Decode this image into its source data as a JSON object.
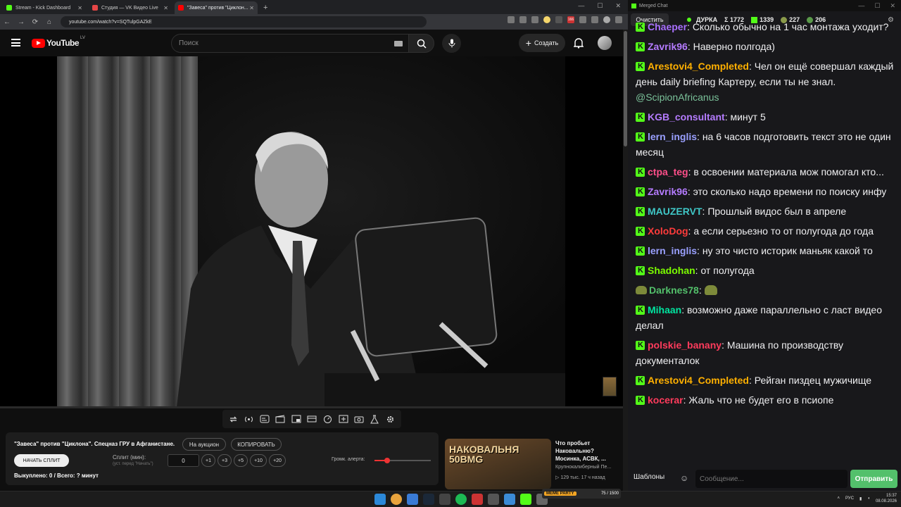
{
  "browser": {
    "tabs": [
      {
        "label": "Stream - Kick Dashboard",
        "color": "#53fc18"
      },
      {
        "label": "Студия — VK Видео Live",
        "color": "#e64646"
      },
      {
        "label": "\"Завеса\" против \"Циклон...",
        "color": "#ff0000"
      }
    ],
    "url": "youtube.com/watch?v=SQTulpGAZkE",
    "ext_badge": "166"
  },
  "youtube": {
    "logo": "YouTube",
    "region": "LV",
    "search_placeholder": "Поиск",
    "create_label": "Создать"
  },
  "panel": {
    "title": "\"Завеса\" против \"Циклона\". Спецназ ГРУ в Афганистане.",
    "auction_label": "На аукцион",
    "copy_label": "КОПИРОВАТЬ",
    "start_label": "НАЧАТЬ СПЛИТ",
    "split_label": "Сплит (мин):",
    "split_hint": "(уст. перед \"Начать\")",
    "split_value": "0",
    "increments": [
      "+1",
      "+3",
      "+5",
      "+10",
      "+20"
    ],
    "bought": "Выкуплено: 0 / Всего: ? минут",
    "volume_label": "Громк. алерта:",
    "volume_fraction": 0.22
  },
  "recommended": {
    "thumb_text": "НАКОВАЛЬНЯ 50BMG",
    "title": "Что пробьет Наковальню? Мосинка, АСВК, ...",
    "channel": "Крупнокалиберный Пе...",
    "meta": "▷ 129 тыс.   17 ч назад"
  },
  "chat": {
    "window_title": "Merged Chat",
    "clear_label": "Очистить",
    "channel": "ДУРКА",
    "stat_total": "Σ 1772",
    "stat_kick": "1339",
    "stat_a": "227",
    "stat_b": "206",
    "messages": [
      {
        "user": "Chaeper",
        "color": "#a970ff",
        "text": "Сколько обычно на 1 час монтажа уходит?"
      },
      {
        "user": "Zavrik96",
        "color": "#b57cff",
        "text": "Наверно полгода)"
      },
      {
        "user": "Arestovi4_Completed",
        "color": "#ffb000",
        "text": "Чел он ещё совершал каждый день daily briefing Картеру, если ты не знал.",
        "mention": "@ScipionAfricanus"
      },
      {
        "user": "KGB_consultant",
        "color": "#b57cff",
        "text": "минут 5"
      },
      {
        "user": "lern_inglis",
        "color": "#9aa0ff",
        "text": "на 6 часов подготовить текст это не один месяц"
      },
      {
        "user": "ctpa_teg",
        "color": "#ff4f8a",
        "text": "в освоении материала мож помогал кто..."
      },
      {
        "user": "Zavrik96",
        "color": "#b57cff",
        "text": "это сколько надо времени по поиску инфу"
      },
      {
        "user": "MAUZERVT",
        "color": "#3fc7c7",
        "text": "Прошлый видос был в апреле"
      },
      {
        "user": "XoloDog",
        "color": "#ff3b3b",
        "text": "а если серьезно то от полугода до года"
      },
      {
        "user": "lern_inglis",
        "color": "#9aa0ff",
        "text": "ну это чисто историк маньяк какой то"
      },
      {
        "user": "Shadohan",
        "color": "#7cfc00",
        "text": "от полугода"
      },
      {
        "user": "Darknes78",
        "color": "#53c06b",
        "text": "",
        "badge": "pepe"
      },
      {
        "user": "Mihaan",
        "color": "#00e5a0",
        "text": "возможно даже  параллельно с ласт видео делал"
      },
      {
        "user": "polskie_banany",
        "color": "#ff3b5c",
        "text": "Машина по производству документалок"
      },
      {
        "user": "Arestovi4_Completed",
        "color": "#ffb000",
        "text": "Рейган пиздец мужичище"
      },
      {
        "user": "kocerar",
        "color": "#ff3b5c",
        "text": "Жаль что не будет его в псиопе"
      }
    ],
    "templates_label": "Шаблоны",
    "input_placeholder": "Сообщение...",
    "send_label": "Отправить"
  },
  "taskbar": {
    "meme_label": "MEME PARTY",
    "meme_count": "75 / 1500",
    "lang": "РУС",
    "time": "15:37",
    "date": "08.08.2026"
  }
}
